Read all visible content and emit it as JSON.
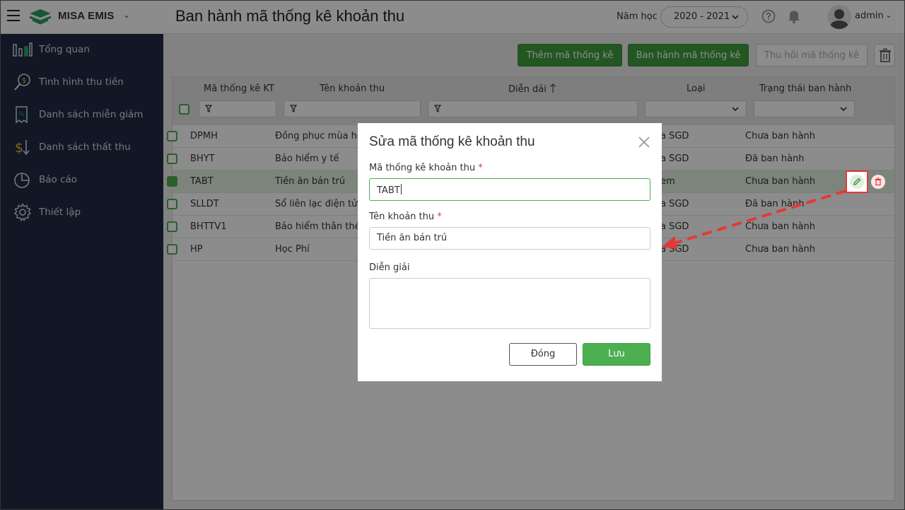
{
  "header": {
    "brand": "MISA EMIS",
    "title": "Ban hành mã thống kê khoản thu",
    "year_label": "Năm học",
    "year_value": "2020 - 2021",
    "user_name": "admin"
  },
  "sidebar": {
    "items": [
      {
        "label": "Tổng quan",
        "icon": "bar-chart-icon"
      },
      {
        "label": "Tình hình thu tiền",
        "icon": "money-search-icon"
      },
      {
        "label": "Danh sách miễn giảm",
        "icon": "discount-icon"
      },
      {
        "label": "Danh sách thất thu",
        "icon": "dollar-down-icon"
      },
      {
        "label": "Báo cáo",
        "icon": "pie-chart-icon"
      },
      {
        "label": "Thiết lập",
        "icon": "gear-icon"
      }
    ]
  },
  "toolbar": {
    "add_label": "Thêm mã thống kê",
    "issue_label": "Ban hành mã thống kê",
    "revoke_label": "Thu hồi mã thống kê"
  },
  "table": {
    "columns": [
      "Mã thống kê KT",
      "Tên khoản thu",
      "Diễn dải",
      "Loại",
      "Trạng thái ban hành"
    ],
    "rows": [
      {
        "code": "DPMH",
        "name": "Đồng phục mùa hè",
        "type": "a SGD",
        "status": "Chưa ban hành",
        "selected": false
      },
      {
        "code": "BHYT",
        "name": "Bảo hiểm y tế",
        "type": "a SGD",
        "status": "Đã ban hành",
        "selected": false
      },
      {
        "code": "TABT",
        "name": "Tiền ăn bán trú",
        "type": "em",
        "status": "Chưa ban hành",
        "selected": true
      },
      {
        "code": "SLLDT",
        "name": "Sổ liên lạc điện tử",
        "type": "a SGD",
        "status": "Đã ban hành",
        "selected": false
      },
      {
        "code": "BHTTV1",
        "name": "Bảo hiểm thân thể V",
        "type": "a SGD",
        "status": "Chưa ban hành",
        "selected": false
      },
      {
        "code": "HP",
        "name": "Học Phí",
        "type": "a SGD",
        "status": "Chưa ban hành",
        "selected": false
      }
    ]
  },
  "modal": {
    "title": "Sửa mã thống kê khoản thu",
    "code_label": "Mã thống kê khoản thu",
    "code_value": "TABT",
    "name_label": "Tên khoản thu",
    "name_value": "Tiền ăn bán trú",
    "desc_label": "Diễn giải",
    "desc_value": "",
    "required_mark": "*",
    "close_label": "Đóng",
    "save_label": "Lưu"
  },
  "colors": {
    "primary_green": "#3f9e3f",
    "sidebar_bg": "#1f2a44",
    "annotation_red": "#e53935"
  }
}
